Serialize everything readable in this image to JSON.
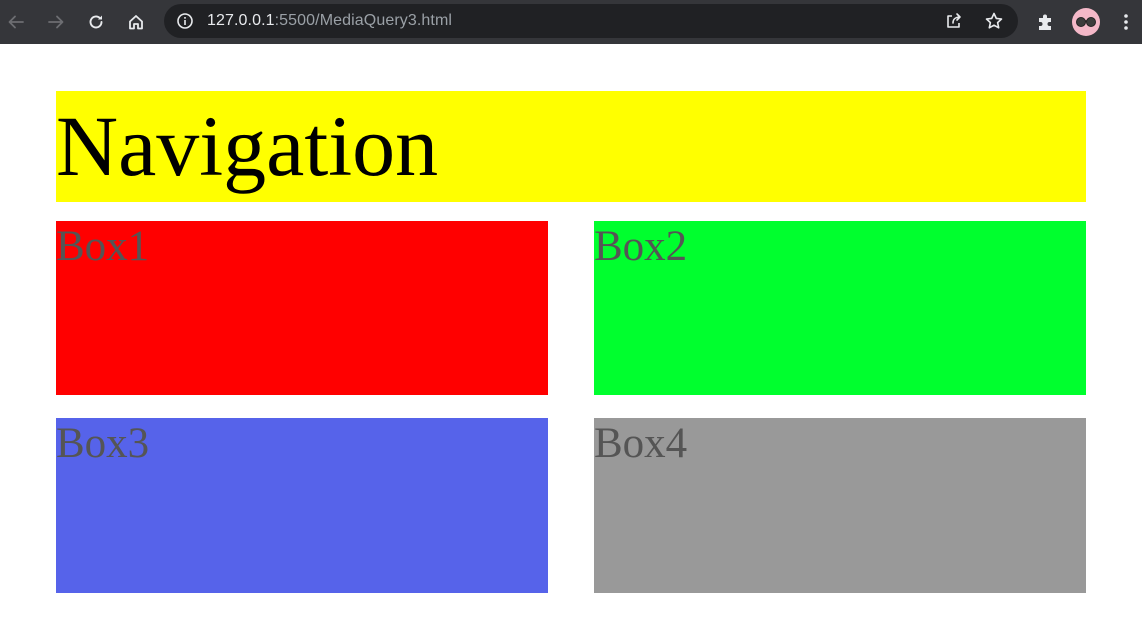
{
  "browser": {
    "url_host": "127.0.0.1",
    "url_path": ":5500/MediaQuery3.html",
    "toolbar_color": "#35363a",
    "omnibox_color": "#202124",
    "icons": [
      "back-arrow-icon",
      "forward-arrow-icon",
      "reload-icon",
      "home-icon",
      "site-info-icon",
      "share-icon",
      "bookmark-star-icon",
      "extensions-puzzle-icon",
      "profile-avatar",
      "kebab-menu-icon"
    ]
  },
  "page": {
    "navigation": {
      "label": "Navigation",
      "color": "#ffff00"
    },
    "boxes": [
      {
        "label": "Box1",
        "color": "#ff0000"
      },
      {
        "label": "Box2",
        "color": "#00ff2e"
      },
      {
        "label": "Box3",
        "color": "#5663ea"
      },
      {
        "label": "Box4",
        "color": "#999999"
      }
    ]
  }
}
